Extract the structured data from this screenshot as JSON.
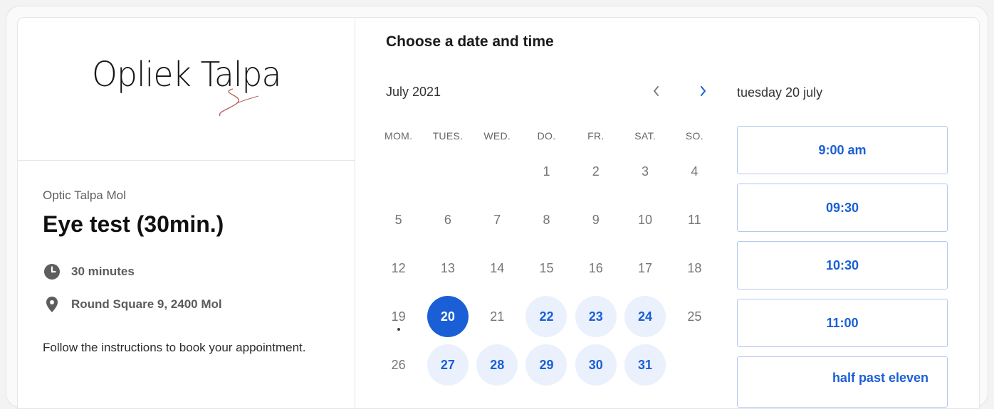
{
  "brand": {
    "logo_text": "Opliek Talpa",
    "accent": "#1a5fd6"
  },
  "event": {
    "organization": "Optic Talpa Mol",
    "title": "Eye test (30min.)",
    "duration": "30 minutes",
    "location": "Round Square 9, 2400 Mol",
    "instructions": "Follow the instructions to book your appointment.",
    "icons": {
      "duration": "clock-icon",
      "location": "map-pin-icon"
    }
  },
  "scheduler": {
    "heading": "Choose a date and time",
    "month_label": "July 2021",
    "prev_icon": "chevron-left-icon",
    "next_icon": "chevron-right-icon",
    "weekdays": [
      "MOM.",
      "TUES.",
      "WED.",
      "DO.",
      "FR.",
      "SAT.",
      "SO."
    ],
    "weeks": [
      [
        null,
        null,
        null,
        "1",
        "2",
        "3",
        "4"
      ],
      [
        "5",
        "6",
        "7",
        "8",
        "9",
        "10",
        "11"
      ],
      [
        "12",
        "13",
        "14",
        "15",
        "16",
        "17",
        "18"
      ],
      [
        "19",
        "20",
        "21",
        "22",
        "23",
        "24",
        "25"
      ],
      [
        "26",
        "27",
        "28",
        "29",
        "30",
        "31",
        null
      ]
    ],
    "available_days": [
      "20",
      "22",
      "23",
      "24",
      "27",
      "28",
      "29",
      "30",
      "31"
    ],
    "selected_day": "20",
    "today_day": "19",
    "selected_date_label": "tuesday 20 july",
    "time_slots": [
      "9:00 am",
      "09:30",
      "10:30",
      "11:00",
      "half past eleven"
    ]
  }
}
